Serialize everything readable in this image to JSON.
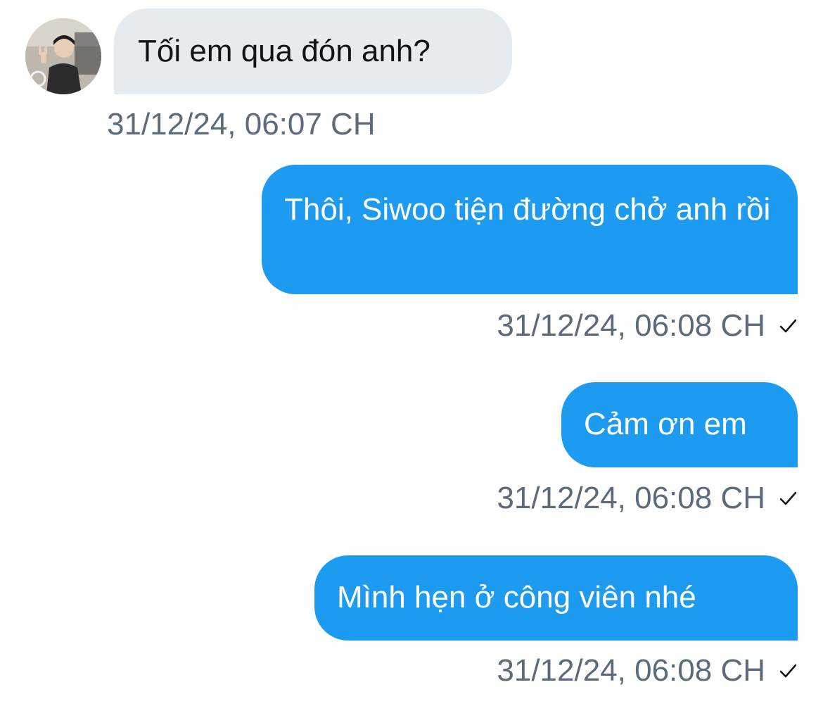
{
  "conversation": {
    "messages": [
      {
        "direction": "received",
        "text": "Tối em qua đón anh?",
        "timestamp": "31/12/24, 06:07 CH"
      },
      {
        "direction": "sent",
        "text": "Thôi, Siwoo tiện đường chở anh rồi",
        "timestamp": "31/12/24, 06:08 CH",
        "status_icon": "check-icon"
      },
      {
        "direction": "sent",
        "text": "Cảm ơn em",
        "timestamp": "31/12/24, 06:08 CH",
        "status_icon": "check-icon"
      },
      {
        "direction": "sent",
        "text": "Mình hẹn ở công viên nhé",
        "timestamp": "31/12/24, 06:08 CH",
        "status_icon": "check-icon"
      }
    ]
  },
  "colors": {
    "sent_bubble": "#1d9bf0",
    "received_bubble": "#e6ebef",
    "timestamp_text": "#5b6b7b"
  }
}
